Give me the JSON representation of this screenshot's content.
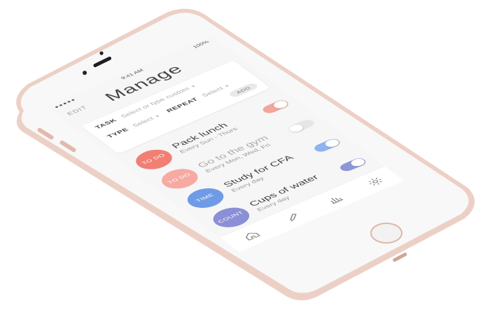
{
  "status_bar": {
    "time": "9:41 AM",
    "signal": "●●●●●",
    "battery": "100%"
  },
  "header": {
    "edit_label": "EDIT",
    "title": "Manage"
  },
  "form": {
    "task_label": "TASK",
    "task_placeholder": "Select or type custom",
    "type_label": "TYPE",
    "type_placeholder": "Select",
    "repeat_label": "REPEAT",
    "repeat_placeholder": "Select",
    "add_label": "ADD"
  },
  "tasks": [
    {
      "badge": "TO DO",
      "badge_color": "#f27f74",
      "name": "Pack lunch",
      "repeat": "Every Sun - Thurs",
      "toggle_on": true,
      "toggle_color": "#f3a49b"
    },
    {
      "badge": "TO DO",
      "badge_color": "#f6aaa2",
      "name": "Go to the gym",
      "repeat": "Every Mon, Wed, Fri",
      "toggle_on": false,
      "toggle_color": "#e6e6e8"
    },
    {
      "badge": "TIME",
      "badge_color": "#6f9be6",
      "name": "Study for CFA",
      "repeat": "Every day",
      "toggle_on": true,
      "toggle_color": "#8eb3ee"
    },
    {
      "badge": "COUNT",
      "badge_color": "#8a8fd6",
      "name": "Cups of water",
      "repeat": "Every day",
      "toggle_on": true,
      "toggle_color": "#8c96d8"
    }
  ],
  "tab_bar": {
    "items": [
      {
        "icon": "home-icon"
      },
      {
        "icon": "pencil-icon"
      },
      {
        "icon": "bar-chart-icon"
      },
      {
        "icon": "gear-icon"
      }
    ]
  },
  "colors": {
    "phone_frame": "#f2ddd5",
    "phone_face": "#f7f7f7",
    "screen_bg": "#f6f6f7"
  }
}
